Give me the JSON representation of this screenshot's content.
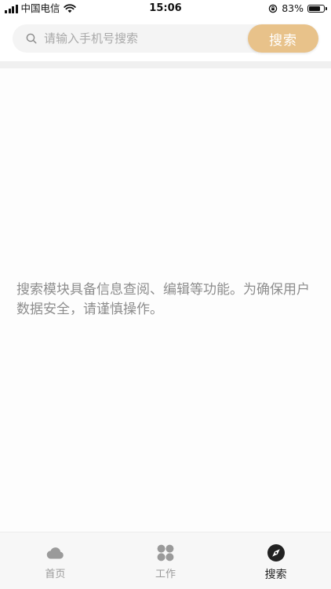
{
  "status_bar": {
    "carrier": "中国电信",
    "time": "15:06",
    "battery_percent": "83%",
    "battery_level": 0.83,
    "icons": [
      "signal-icon",
      "wifi-icon",
      "orientation-lock-icon",
      "battery-icon"
    ]
  },
  "search": {
    "placeholder": "请输入手机号搜索",
    "value": "",
    "button_label": "搜索",
    "icon": "search-icon"
  },
  "notice": {
    "text": "搜索模块具备信息查阅、编辑等功能。为确保用户数据安全，请谨慎操作。"
  },
  "tabs": [
    {
      "label": "首页",
      "icon": "cloud-icon",
      "active": false
    },
    {
      "label": "工作",
      "icon": "grid-icon",
      "active": false
    },
    {
      "label": "搜索",
      "icon": "compass-icon",
      "active": true
    }
  ],
  "colors": {
    "accent": "#e8c28a",
    "tab_inactive": "#9a9a9a",
    "tab_active": "#222222",
    "notice_text": "#8d8d8d"
  }
}
